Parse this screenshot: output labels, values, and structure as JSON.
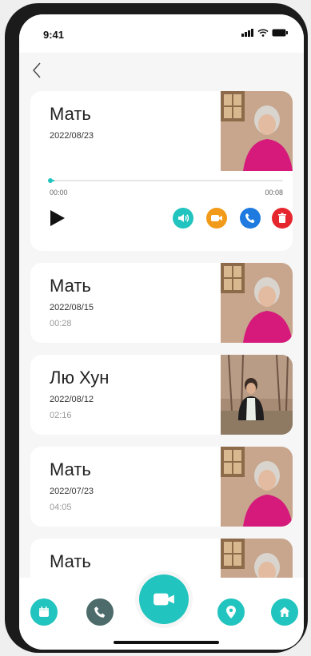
{
  "status_bar": {
    "time": "9:41"
  },
  "colors": {
    "accent": "#21c4be",
    "orange": "#f29a19",
    "blue": "#1f7ae0",
    "red": "#e6262e",
    "phone_gray": "#4c6b6a"
  },
  "detail": {
    "name": "Мать",
    "date": "2022/08/23",
    "time_start": "00:00",
    "time_end": "00:08",
    "progress": 0.02,
    "actions": [
      "speaker-icon",
      "video-call-icon",
      "phone-icon",
      "delete-icon"
    ]
  },
  "records": [
    {
      "name": "Мать",
      "date": "2022/08/15",
      "duration": "00:28"
    },
    {
      "name": "Лю Хун",
      "date": "2022/08/12",
      "duration": "02:16"
    },
    {
      "name": "Мать",
      "date": "2022/07/23",
      "duration": "04:05"
    },
    {
      "name": "Мать",
      "date": "",
      "duration": ""
    }
  ],
  "bottom_nav": [
    "calendar-icon",
    "phone-icon",
    "video-camera-icon",
    "location-icon",
    "home-icon"
  ]
}
